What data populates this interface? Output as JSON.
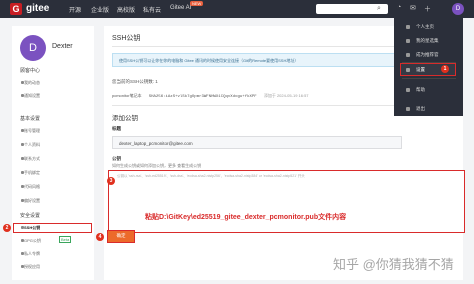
{
  "topnav": {
    "logo_letter": "G",
    "brand": "gitee",
    "items": [
      "开源",
      "企业版",
      "高校版",
      "私有云",
      "Gitee AI"
    ],
    "new_badge": "NEW",
    "search_icon": "search-icon"
  },
  "sidebar": {
    "avatar_letter": "D",
    "username": "Dexter",
    "sections": [
      {
        "title": "顾客中心",
        "items": [
          "我的动态",
          "通知设置"
        ]
      },
      {
        "title": "基本设置",
        "items": [
          "账号管理",
          "个人资料",
          "联系方式",
          "手机绑定",
          "代码风格",
          "偏好设置"
        ]
      },
      {
        "title": "安全设置",
        "items": [
          "SSH公钥",
          "GPG公钥",
          "私人令牌",
          "授权应用"
        ]
      }
    ],
    "gpg_badge": "Beta",
    "step_ssh": "2"
  },
  "main": {
    "title": "SSH公钥",
    "info": "使用SSH公钥可以让你在你的电脑和 Gitee 通讯的时候使用安全连接（Git的Remote要使用SSH地址）",
    "added_count": "您当前的SSH公钥数: 1",
    "key_name": "pcmonitor笔记本",
    "key_fingerprint": "SHA256:iAzS+vlSk7gOpmr3WFNHWX1CQqvXdogu+fkXPF",
    "key_date": "添加于 2024-05-19 16:57",
    "add_title": "添加公钥",
    "title_label": "标题",
    "title_value": "dexter_laptop_pcmonitor@gitee.com",
    "pubkey_label": "公钥",
    "helper": "如何生成公钥或如何添加公钥，更多 查看生成公钥",
    "placeholder": "公钥以 'ssh-rsa'、'ssh-ed25519'、'ssh-dss'、'ecdsa-sha2-nistp256'、'ecdsa-sha2-nistp384' or 'ecdsa-sha2-nistp521' 开头",
    "paste_note": "粘贴D:\\GitKey\\ed25519_gitee_dexter_pcmonitor.pub文件内容",
    "step_paste": "3",
    "confirm_label": "确定",
    "step_confirm": "4"
  },
  "dropdown": {
    "items": [
      "个人主页",
      "我的星选集",
      "成为推荐官",
      "设置",
      "帮助",
      "退出"
    ],
    "step_settings": "1"
  },
  "watermark": "知乎 @你猜我猜不猜",
  "colors": {
    "accent": "#c71d23",
    "highlight": "#d92b2b",
    "button": "#ec6a2a",
    "navbar": "#2b2f3a"
  }
}
